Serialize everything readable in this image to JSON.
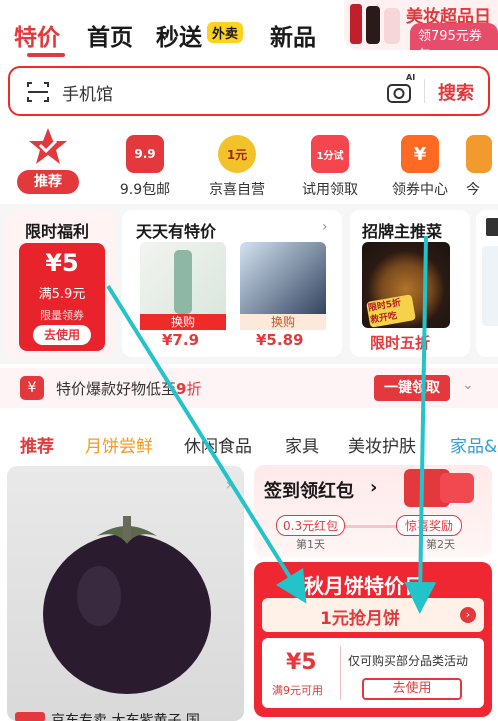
{
  "topnav": {
    "tabs": [
      "特价",
      "首页",
      "秒送",
      "新品"
    ],
    "waimai": "外卖"
  },
  "promo": {
    "title": "美妆超品日",
    "coupon": "领795元券包"
  },
  "search": {
    "value": "手机馆",
    "button": "搜索",
    "ai": "AI"
  },
  "categories": [
    {
      "label": "推荐"
    },
    {
      "label": "9.9包邮",
      "icon_text": "9.9"
    },
    {
      "label": "京喜自营",
      "icon_text": "1元"
    },
    {
      "label": "试用领取",
      "icon_text": "1分试"
    },
    {
      "label": "领券中心",
      "icon_text": "¥"
    },
    {
      "label": "今"
    }
  ],
  "limited": {
    "title": "限时福利",
    "amount": "¥5",
    "cond": "满5.9元",
    "sub": "限量领券",
    "btn": "去使用"
  },
  "daily": {
    "title": "天天有特价",
    "items": [
      {
        "tag": "换购",
        "price": "¥7.9"
      },
      {
        "tag": "换购",
        "price": "¥5.89"
      }
    ]
  },
  "host": {
    "title": "招牌主推菜",
    "tag": "限时五折",
    "stamp": "限时5折 救开吃"
  },
  "sale": {
    "text": "特价爆款好物低至",
    "num": "9",
    "unit": "折",
    "btn": "一键领取"
  },
  "tabs": [
    "推荐",
    "月饼尝鲜",
    "休闲食品",
    "家具",
    "美妆护肤",
    "家品&"
  ],
  "checkin": {
    "title": "签到领红包",
    "left_tag": "0.3元红包",
    "day1": "第1天",
    "right_tag": "惊喜奖励",
    "day2": "第2天"
  },
  "mooncake": {
    "banner": "中秋月饼特价日",
    "btn": "1元抢月饼",
    "amount": "¥5",
    "cond": "满9元可用",
    "desc": "仅可购买部分品类活动",
    "use": "去使用"
  },
  "bottom": {
    "text": "京东专卖 大东紫黄子 国"
  }
}
